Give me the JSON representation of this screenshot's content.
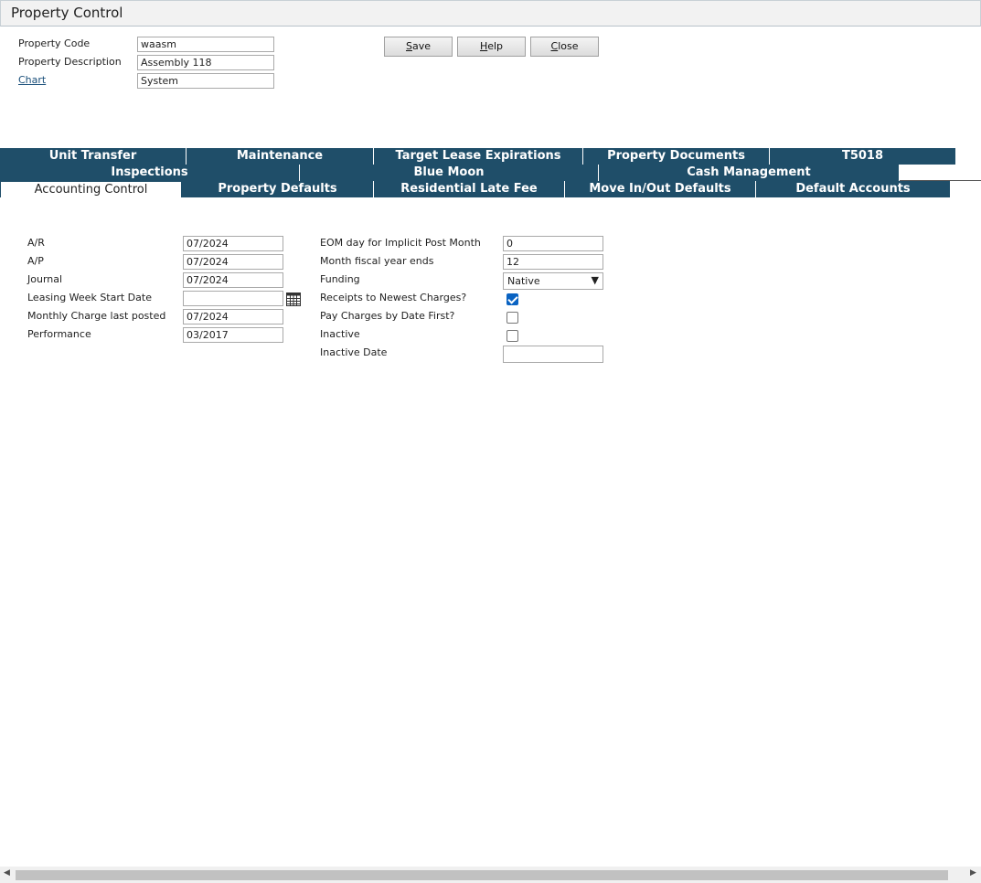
{
  "window": {
    "title": "Property Control"
  },
  "header": {
    "property_code_label": "Property Code",
    "property_code_value": "waasm",
    "property_description_label": "Property Description",
    "property_description_value": "Assembly 118",
    "chart_link": "Chart",
    "chart_value": "System"
  },
  "buttons": {
    "save": "Save",
    "help": "Help",
    "close": "Close"
  },
  "tabs": {
    "row1": [
      "Unit Transfer",
      "Maintenance",
      "Target Lease Expirations",
      "Property Documents",
      "T5018"
    ],
    "row2": [
      "Inspections",
      "Blue Moon",
      "Cash Management"
    ],
    "row3": [
      "Accounting Control",
      "Property Defaults",
      "Residential Late Fee",
      "Move In/Out Defaults",
      "Default Accounts"
    ],
    "active": "Accounting Control"
  },
  "left_form": {
    "ar_label": "A/R",
    "ar_value": "07/2024",
    "ap_label": "A/P",
    "ap_value": "07/2024",
    "journal_label": "Journal",
    "journal_value": "07/2024",
    "leasing_week_label": "Leasing Week Start Date",
    "leasing_week_value": "",
    "monthly_charge_label": "Monthly Charge last posted",
    "monthly_charge_value": "07/2024",
    "performance_label": "Performance",
    "performance_value": "03/2017"
  },
  "right_form": {
    "eom_label": "EOM day for Implicit Post Month",
    "eom_value": "0",
    "fiscal_label": "Month fiscal year ends",
    "fiscal_value": "12",
    "funding_label": "Funding",
    "funding_value": "Native",
    "receipts_label": "Receipts to Newest Charges?",
    "receipts_checked": true,
    "pay_charges_label": "Pay Charges by Date First?",
    "pay_charges_checked": false,
    "inactive_label": "Inactive",
    "inactive_checked": false,
    "inactive_date_label": "Inactive Date",
    "inactive_date_value": ""
  },
  "icons": {
    "calendar": "calendar-icon",
    "scroll_left": "scroll-left-icon",
    "scroll_right": "scroll-right-icon"
  },
  "colors": {
    "tab_bg": "#1f4e69",
    "checkbox_checked": "#0a63c2"
  }
}
